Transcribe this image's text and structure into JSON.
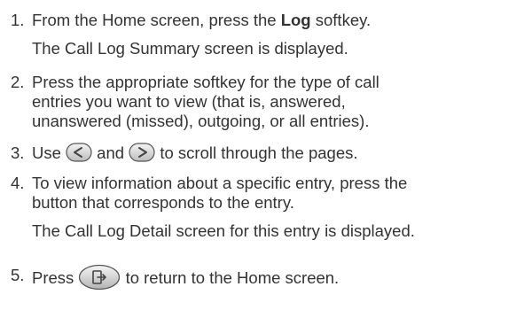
{
  "steps": [
    {
      "number": "1.",
      "lines": [
        "From the Home screen, press the ",
        "Log",
        " softkey."
      ],
      "note": "The Call Log Summary screen is displayed."
    },
    {
      "number": "2.",
      "lines": [
        "Press the appropriate softkey for the type of call",
        "entries you want to view (that is, answered,",
        "unanswered (missed), outgoing, or all entries)."
      ]
    },
    {
      "number": "3.",
      "before": "Use ",
      "between": " and ",
      "after": " to scroll through the pages.",
      "icons": [
        "left-arrow-button-icon",
        "right-arrow-button-icon"
      ]
    },
    {
      "number": "4.",
      "lines": [
        "To view information about a specific entry, press the",
        "button that corresponds to the entry."
      ],
      "note": "The Call Log Detail screen for this entry is displayed."
    },
    {
      "number": "5.",
      "before": "Press ",
      "after": " to return to the Home screen.",
      "icons": [
        "home-return-button-icon"
      ]
    }
  ]
}
